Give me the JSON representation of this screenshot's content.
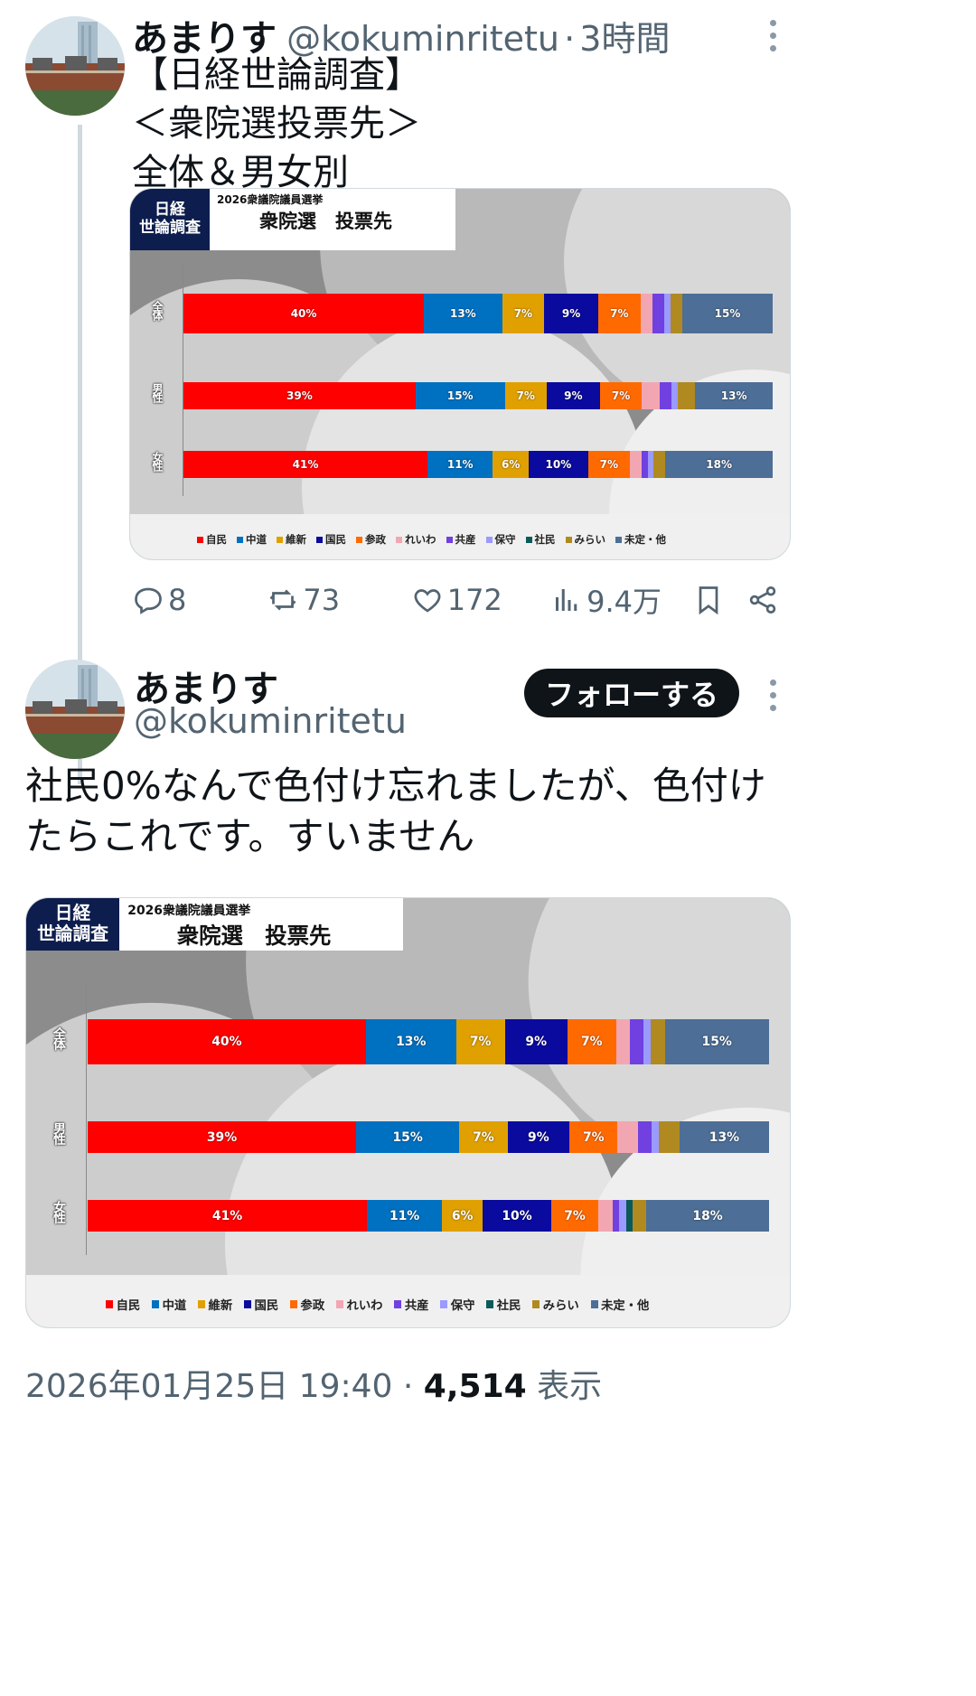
{
  "tweet1": {
    "name": "あまりす",
    "handle": "@kokuminritetu",
    "separator": "·",
    "time": "3時間",
    "text": "【日経世論調査】\n＜衆院選投票先＞\n全体＆男女別",
    "stats": {
      "replies": "8",
      "retweets": "73",
      "likes": "172",
      "views": "9.4万"
    }
  },
  "tweet2": {
    "name": "あまりす",
    "handle": "@kokuminritetu",
    "follow_label": "フォローする",
    "text": "社民0%なんで色付け忘れましたが、色付けたらこれです。すいません",
    "date": "2026年01月25日 19:40",
    "dot": "·",
    "views": "4,514",
    "views_label": "表示"
  },
  "chart_header": {
    "tag_line1": "日経",
    "tag_line2": "世論調査",
    "subtitle": "2026衆議院議員選挙",
    "title": "衆院選　投票先"
  },
  "colors": {
    "自民": "#ff0000",
    "中道": "#0070c0",
    "維新": "#e0a000",
    "国民": "#0a0a9e",
    "参政": "#ff6a00",
    "れいわ": "#f2a6b2",
    "共産": "#7040e0",
    "保守": "#9a9aff",
    "社民": "#0b5a5a",
    "みらい": "#b08a20",
    "未定・他": "#4d6e96"
  },
  "chart_data": [
    {
      "type": "bar",
      "stacked": true,
      "orientation": "horizontal",
      "title": "衆院選　投票先",
      "subtitle": "2026衆議院議員選挙",
      "categories": [
        "全体",
        "男性",
        "女性"
      ],
      "legend": [
        "自民",
        "中道",
        "維新",
        "国民",
        "参政",
        "れいわ",
        "共産",
        "保守",
        "社民",
        "みらい",
        "未定・他"
      ],
      "legend_placement": "bottom",
      "rows": [
        {
          "label": "全体",
          "values": [
            40,
            13,
            7,
            9,
            7,
            2,
            2,
            1,
            0,
            2,
            15
          ],
          "labels": [
            "40%",
            "13%",
            "7%",
            "9%",
            "7%",
            "",
            "",
            "",
            "",
            "",
            "15%"
          ]
        },
        {
          "label": "男性",
          "values": [
            39,
            15,
            7,
            9,
            7,
            3,
            2,
            1,
            0,
            3,
            13
          ],
          "labels": [
            "39%",
            "15%",
            "7%",
            "9%",
            "7%",
            "",
            "",
            "",
            "",
            "",
            "13%"
          ]
        },
        {
          "label": "女性",
          "values": [
            41,
            11,
            6,
            10,
            7,
            2,
            1,
            1,
            0,
            2,
            18
          ],
          "labels": [
            "41%",
            "11%",
            "6%",
            "10%",
            "7%",
            "",
            "",
            "",
            "",
            "",
            "18%"
          ]
        }
      ]
    },
    {
      "type": "bar",
      "stacked": true,
      "orientation": "horizontal",
      "title": "衆院選　投票先",
      "subtitle": "2026衆議院議員選挙",
      "categories": [
        "全体",
        "男性",
        "女性"
      ],
      "legend": [
        "自民",
        "中道",
        "維新",
        "国民",
        "参政",
        "れいわ",
        "共産",
        "保守",
        "社民",
        "みらい",
        "未定・他"
      ],
      "legend_placement": "bottom",
      "rows": [
        {
          "label": "全体",
          "values": [
            40,
            13,
            7,
            9,
            7,
            2,
            2,
            1,
            0,
            2,
            15
          ],
          "labels": [
            "40%",
            "13%",
            "7%",
            "9%",
            "7%",
            "",
            "",
            "",
            "",
            "",
            "15%"
          ]
        },
        {
          "label": "男性",
          "values": [
            39,
            15,
            7,
            9,
            7,
            3,
            2,
            1,
            0,
            3,
            13
          ],
          "labels": [
            "39%",
            "15%",
            "7%",
            "9%",
            "7%",
            "",
            "",
            "",
            "",
            "",
            "13%"
          ]
        },
        {
          "label": "女性",
          "values": [
            41,
            11,
            6,
            10,
            7,
            2,
            1,
            1,
            1,
            2,
            18
          ],
          "labels": [
            "41%",
            "11%",
            "6%",
            "10%",
            "7%",
            "",
            "",
            "",
            "",
            "",
            "18%"
          ]
        }
      ]
    }
  ]
}
